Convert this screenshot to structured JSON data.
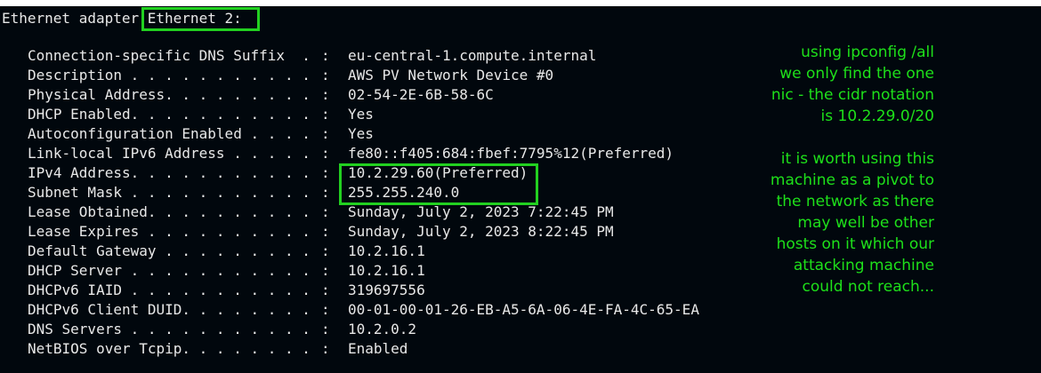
{
  "header": {
    "prefix": "Ethernet adapter ",
    "adapter": "Ethernet 2:"
  },
  "rows": [
    {
      "label": "Connection-specific DNS Suffix  .",
      "value": "eu-central-1.compute.internal"
    },
    {
      "label": "Description . . . . . . . . . . .",
      "value": "AWS PV Network Device #0"
    },
    {
      "label": "Physical Address. . . . . . . . .",
      "value": "02-54-2E-6B-58-6C"
    },
    {
      "label": "DHCP Enabled. . . . . . . . . . .",
      "value": "Yes"
    },
    {
      "label": "Autoconfiguration Enabled . . . .",
      "value": "Yes"
    },
    {
      "label": "Link-local IPv6 Address . . . . .",
      "value": "fe80::f405:684:fbef:7795%12(Preferred)"
    },
    {
      "label": "IPv4 Address. . . . . . . . . . .",
      "value": "10.2.29.60(Preferred)"
    },
    {
      "label": "Subnet Mask . . . . . . . . . . .",
      "value": "255.255.240.0"
    },
    {
      "label": "Lease Obtained. . . . . . . . . .",
      "value": "Sunday, July 2, 2023 7:22:45 PM"
    },
    {
      "label": "Lease Expires . . . . . . . . . .",
      "value": "Sunday, July 2, 2023 8:22:45 PM"
    },
    {
      "label": "Default Gateway . . . . . . . . .",
      "value": "10.2.16.1"
    },
    {
      "label": "DHCP Server . . . . . . . . . . .",
      "value": "10.2.16.1"
    },
    {
      "label": "DHCPv6 IAID . . . . . . . . . . .",
      "value": "319697556"
    },
    {
      "label": "DHCPv6 Client DUID. . . . . . . .",
      "value": "00-01-00-01-26-EB-A5-6A-06-4E-FA-4C-65-EA"
    },
    {
      "label": "DNS Servers . . . . . . . . . . .",
      "value": "10.2.0.2"
    },
    {
      "label": "NetBIOS over Tcpip. . . . . . . .",
      "value": "Enabled"
    }
  ],
  "separator": ": ",
  "notes": {
    "note1": "using ipconfig /all\nwe only find the one\nnic - the cidr notation\nis 10.2.29.0/20",
    "note2": "it is worth using this\nmachine as a pivot to\nthe network as there\nmay well be other\nhosts on it which our\nattacking machine\ncould not reach..."
  },
  "colors": {
    "background": "#01070d",
    "text": "#e8e8e8",
    "highlight": "#22d020",
    "annotation": "#1ee01a"
  }
}
